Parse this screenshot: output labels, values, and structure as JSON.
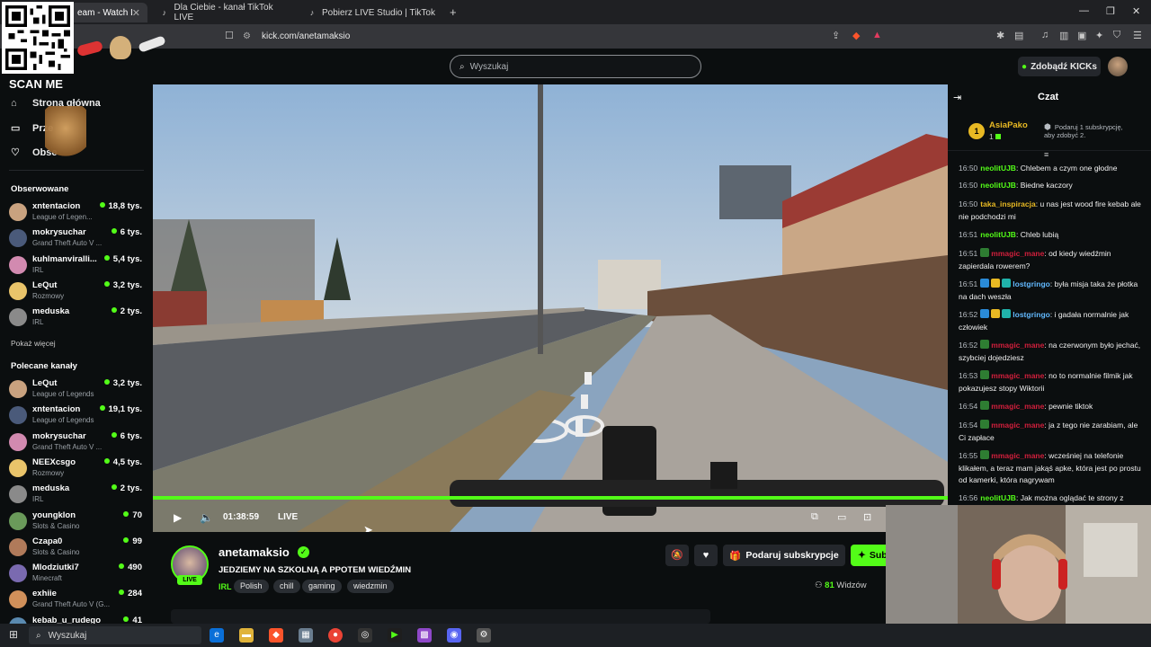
{
  "browser": {
    "tabs": [
      {
        "label": "eam - Watch Li",
        "active": true
      },
      {
        "label": "Dla Ciebie - kanał TikTok LIVE",
        "active": false
      },
      {
        "label": "Pobierz LIVE Studio | TikTok",
        "active": false
      }
    ],
    "url": "kick.com/anetamaksio"
  },
  "overlay": {
    "scan_label": "SCAN ME"
  },
  "header": {
    "search_placeholder": "Wyszukaj",
    "kicks_label": "Zdobądź KICKs"
  },
  "sidebar": {
    "nav": [
      {
        "label": "Strona główna",
        "icon": "home-icon"
      },
      {
        "label": "Prze",
        "icon": "browse-icon"
      },
      {
        "label": "Obse",
        "icon": "heart-icon"
      }
    ],
    "followed_title": "Obserwowane",
    "followed": [
      {
        "name": "xntentacion",
        "game": "League of Legen...",
        "viewers": "18,8 tys."
      },
      {
        "name": "mokrysuchar",
        "game": "Grand Theft Auto V ...",
        "viewers": "6 tys."
      },
      {
        "name": "kuhlmanviralli...",
        "game": "IRL",
        "viewers": "5,4 tys."
      },
      {
        "name": "LeQut",
        "game": "Rozmowy",
        "viewers": "3,2 tys."
      },
      {
        "name": "meduska",
        "game": "IRL",
        "viewers": "2 tys."
      }
    ],
    "show_more": "Pokaż więcej",
    "recommended_title": "Polecane kanały",
    "recommended": [
      {
        "name": "LeQut",
        "game": "League of Legends",
        "viewers": "3,2 tys."
      },
      {
        "name": "xntentacion",
        "game": "League of Legends",
        "viewers": "19,1 tys."
      },
      {
        "name": "mokrysuchar",
        "game": "Grand Theft Auto V ...",
        "viewers": "6 tys."
      },
      {
        "name": "NEEXcsgo",
        "game": "Rozmowy",
        "viewers": "4,5 tys."
      },
      {
        "name": "meduska",
        "game": "IRL",
        "viewers": "2 tys."
      },
      {
        "name": "youngklon",
        "game": "Slots & Casino",
        "viewers": "70"
      },
      {
        "name": "Czapa0",
        "game": "Slots & Casino",
        "viewers": "99"
      },
      {
        "name": "Mlodziutki7",
        "game": "Minecraft",
        "viewers": "490"
      },
      {
        "name": "exhiie",
        "game": "Grand Theft Auto V (G...",
        "viewers": "284"
      },
      {
        "name": "kebab_u_rudego",
        "game": "",
        "viewers": "41"
      }
    ]
  },
  "player": {
    "time": "01:38:59",
    "live_label": "LIVE",
    "progress": 1.0
  },
  "stream": {
    "channel": "anetamaksio",
    "live_badge": "LIVE",
    "title": "JEDZIEMY NA SZKOLNĄ A PPOTEM WIEDŹMIN",
    "category": "IRL",
    "tags": [
      "Polish",
      "chill",
      "gaming",
      "wiedzmin"
    ],
    "gift_label": "Podaruj subskrypcje",
    "sub_label": "Sub",
    "viewers_count": "81",
    "viewers_label": "Widzów"
  },
  "chat": {
    "title": "Czat",
    "pinned": {
      "rank": "1",
      "name": "AsiaPako",
      "count": "1",
      "info": "Podaruj 1 subskrypcję, aby zdobyć 2."
    },
    "messages": [
      {
        "time": "16:50",
        "user": "neolitUJB",
        "color": "#53fc18",
        "text": "Chlebem a czym one głodne"
      },
      {
        "time": "16:50",
        "user": "neolitUJB",
        "color": "#53fc18",
        "text": "Biedne kaczory"
      },
      {
        "time": "16:50",
        "user": "taka_inspiracja",
        "color": "#e8b923",
        "text": "u nas jest wood fire kebab ale nie podchodzi mi"
      },
      {
        "time": "16:51",
        "user": "neolitUJB",
        "color": "#53fc18",
        "text": "Chleb lubią"
      },
      {
        "time": "16:51",
        "user": "mmagic_mane",
        "color": "#d11f3c",
        "text": "od kiedy wiedźmin zapierdala rowerem?"
      },
      {
        "time": "16:51",
        "user": "lostgringo",
        "color": "#62b9ff",
        "text": "była misja taka że płotka na dach weszła"
      },
      {
        "time": "16:52",
        "user": "lostgringo",
        "color": "#62b9ff",
        "text": "i gadała normalnie jak człowiek"
      },
      {
        "time": "16:52",
        "user": "mmagic_mane",
        "color": "#d11f3c",
        "text": "na czerwonym było jechać, szybciej dojedziesz"
      },
      {
        "time": "16:53",
        "user": "mmagic_mane",
        "color": "#d11f3c",
        "text": "no to normalnie filmik jak pokazujesz stopy Wiktorii"
      },
      {
        "time": "16:54",
        "user": "mmagic_mane",
        "color": "#d11f3c",
        "text": "pewnie tiktok"
      },
      {
        "time": "16:54",
        "user": "mmagic_mane",
        "color": "#d11f3c",
        "text": "ja z tego nie zarabiam, ale Ci zapłace"
      },
      {
        "time": "16:55",
        "user": "mmagic_mane",
        "color": "#d11f3c",
        "text": "wcześniej na telefonie klikałem, a teraz mam jakąś apke, która jest po prostu od kamerki, która nagrywam"
      },
      {
        "time": "16:56",
        "user": "neolitUJB",
        "color": "#53fc18",
        "text": "Jak można oglądać te strony z"
      }
    ]
  },
  "taskbar": {
    "search_label": "Wyszukaj"
  },
  "colors": {
    "accent": "#53fc18",
    "background": "#0b0e0f"
  }
}
